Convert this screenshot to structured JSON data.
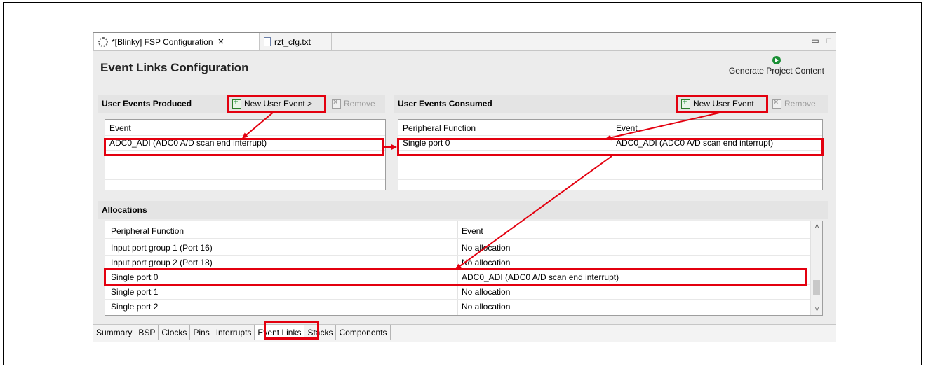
{
  "tabs": [
    {
      "label": "*[Blinky] FSP Configuration",
      "close": "×",
      "icon": "gear-icon"
    },
    {
      "label": "rzt_cfg.txt",
      "icon": "text-file-icon"
    }
  ],
  "window_buttons": {
    "minimize": "▭",
    "maximize": "□"
  },
  "page": {
    "title": "Event Links Configuration",
    "generate_label": "Generate Project Content",
    "generate_icon": "play-icon"
  },
  "produced": {
    "title": "User Events Produced",
    "new_label": "New User Event >",
    "remove_label": "Remove",
    "columns": [
      "Event"
    ],
    "rows": [
      "ADC0_ADI (ADC0 A/D scan end interrupt)"
    ]
  },
  "consumed": {
    "title": "User Events Consumed",
    "new_label": "New User Event",
    "remove_label": "Remove",
    "columns": [
      "Peripheral Function",
      "Event"
    ],
    "rows": [
      [
        "Single port 0",
        "ADC0_ADI (ADC0 A/D scan end interrupt)"
      ]
    ]
  },
  "allocations": {
    "title": "Allocations",
    "columns": [
      "Peripheral Function",
      "Event"
    ],
    "rows": [
      [
        "Input port group 1 (Port 16)",
        "No allocation"
      ],
      [
        "Input port group 2 (Port 18)",
        "No allocation"
      ],
      [
        "Single port 0",
        "ADC0_ADI (ADC0 A/D scan end interrupt)"
      ],
      [
        "Single port 1",
        "No allocation"
      ],
      [
        "Single port 2",
        "No allocation"
      ]
    ],
    "scroll_up": "˄",
    "scroll_down": "˅"
  },
  "bottom_tabs": [
    "Summary",
    "BSP",
    "Clocks",
    "Pins",
    "Interrupts",
    "Event Links",
    "Stacks",
    "Components"
  ],
  "selected_bottom_tab": "Event Links",
  "colors": {
    "highlight": "#e3000f",
    "accent_green": "#1a8f35"
  }
}
